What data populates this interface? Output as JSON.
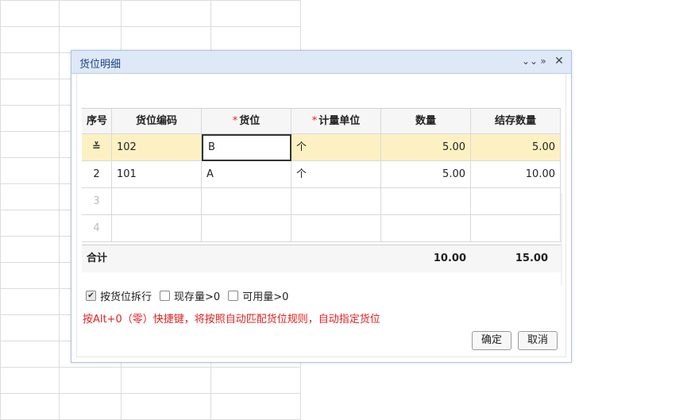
{
  "dialog": {
    "title": "货位明细",
    "tools": {
      "collapse": "≫",
      "expand": "»",
      "close": "✕"
    }
  },
  "grid": {
    "columns": [
      {
        "label": "序号",
        "required": false
      },
      {
        "label": "货位编码",
        "required": false
      },
      {
        "label": "货位",
        "required": true
      },
      {
        "label": "计量单位",
        "required": true
      },
      {
        "label": "数量",
        "required": false
      },
      {
        "label": "结存数量",
        "required": false
      }
    ],
    "required_mark": "*",
    "rows": [
      {
        "index": "",
        "code": "102",
        "location": "B",
        "unit": "个",
        "qty": "5.00",
        "balance": "5.00",
        "selected": true
      },
      {
        "index": "2",
        "code": "101",
        "location": "A",
        "unit": "个",
        "qty": "5.00",
        "balance": "10.00",
        "selected": false
      },
      {
        "index": "3",
        "code": "",
        "location": "",
        "unit": "",
        "qty": "",
        "balance": "",
        "selected": false
      },
      {
        "index": "4",
        "code": "",
        "location": "",
        "unit": "",
        "qty": "",
        "balance": "",
        "selected": false
      }
    ],
    "selected_row_icon": "≚",
    "summary": {
      "label": "合计",
      "qty": "10.00",
      "balance": "15.00"
    }
  },
  "options": [
    {
      "label": "按货位拆行",
      "checked": true
    },
    {
      "label": "现存量>0",
      "checked": false
    },
    {
      "label": "可用量>0",
      "checked": false
    }
  ],
  "hint": "按Alt+0（零）快捷键，将按照自动匹配货位规则，自动指定货位",
  "buttons": {
    "ok": "确定",
    "cancel": "取消"
  }
}
